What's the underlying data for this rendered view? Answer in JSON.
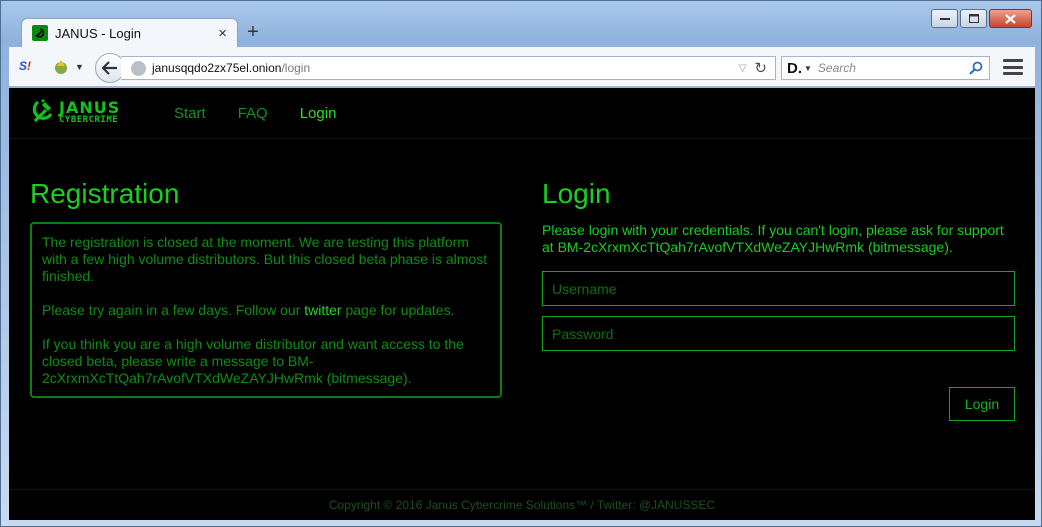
{
  "browser": {
    "tab_title": "JANUS - Login",
    "tab_close": "×",
    "new_tab": "+",
    "url_host": "janusqqdo2zx75el.onion",
    "url_path": "/login",
    "search_placeholder": "Search",
    "search_engine": "D.",
    "nav_icon_label": "S",
    "nav_icon_label_accent": "!"
  },
  "site": {
    "logo_main": "JANUS",
    "logo_sub": "CYBERCRIME",
    "menu": [
      {
        "label": "Start"
      },
      {
        "label": "FAQ"
      },
      {
        "label": "Login"
      }
    ],
    "registration": {
      "heading": "Registration",
      "p1": "The registration is closed at the moment. We are testing this platform with a few high volume distributors. But this closed beta phase is almost finished.",
      "p2_before": "Please try again in a few days. Follow our ",
      "p2_link": "twitter",
      "p2_after": " page for updates.",
      "p3": "If you think you are a high volume distributor and want access to the closed beta, please write a message to BM-2cXrxmXcTtQah7rAvofVTXdWeZAYJHwRmk (bitmessage)."
    },
    "login": {
      "heading": "Login",
      "description": "Please login with your credentials. If you can't login, please ask for support at BM-2cXrxmXcTtQah7rAvofVTXdWeZAYJHwRmk (bitmessage).",
      "username_placeholder": "Username",
      "password_placeholder": "Password",
      "button": "Login"
    },
    "footer": "Copyright © 2016 Janus Cybercrime Solutions™ / Twitter: @JANUSSEC"
  },
  "colors": {
    "accent": "#17d11f",
    "background": "#000000"
  }
}
